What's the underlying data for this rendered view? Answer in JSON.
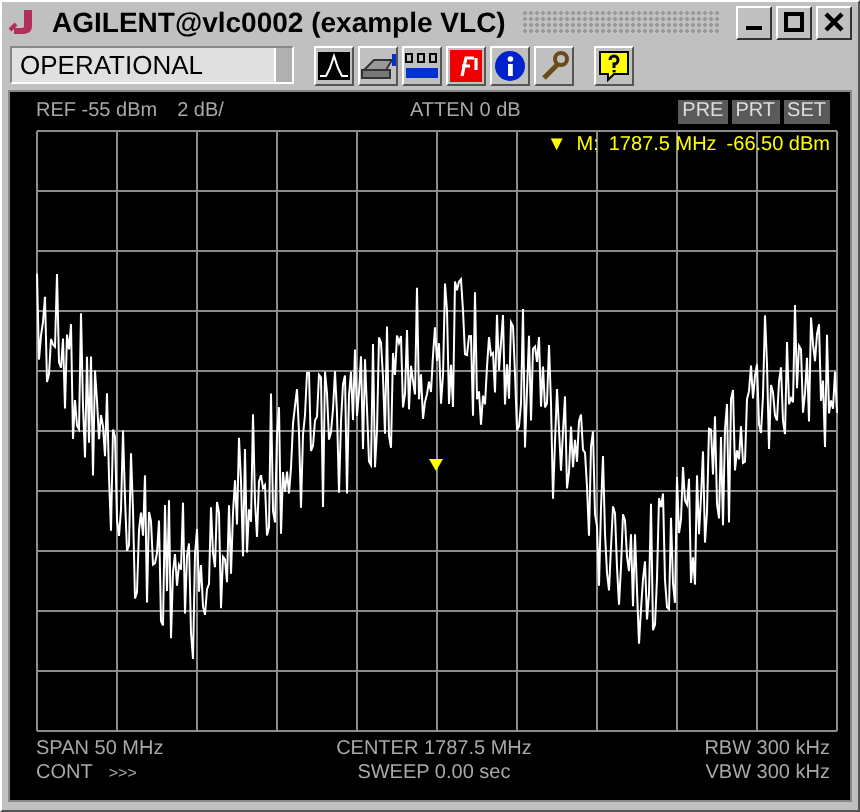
{
  "window": {
    "title": "AGILENT@vlc0002 (example VLC)"
  },
  "status": {
    "value": "OPERATIONAL"
  },
  "display": {
    "ref": "REF -55 dBm",
    "scale": "2 dB/",
    "atten": "ATTEN 0 dB",
    "softkeys": [
      "PRE",
      "PRT",
      "SET"
    ],
    "marker": {
      "symbol": "▼",
      "label": "M:",
      "frequency": "1787.5 MHz",
      "level": "-66.50 dBm"
    },
    "span": "SPAN 50 MHz",
    "center": "CENTER 1787.5 MHz",
    "rbw": "RBW 300 kHz",
    "mode": "CONT",
    "mode_arrows": ">>>",
    "sweep": "SWEEP 0.00 sec",
    "vbw": "VBW 300 kHz"
  }
}
